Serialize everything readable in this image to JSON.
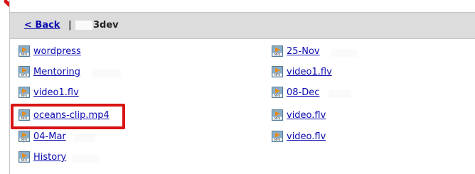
{
  "nav": {
    "back_label": "< Back",
    "separator": "|",
    "folder": "3dev"
  },
  "files_left": [
    {
      "name": "wordpress",
      "icon": "mp4-file-icon"
    },
    {
      "name": "Mentoring",
      "icon": "mp4-file-icon"
    },
    {
      "name": "video1.flv",
      "icon": "mp4-file-icon"
    },
    {
      "name": "oceans-clip.mp4",
      "icon": "mp4-file-icon"
    },
    {
      "name": "04-Mar",
      "icon": "mp4-file-icon"
    },
    {
      "name": "History",
      "icon": "mp4-file-icon"
    }
  ],
  "files_right": [
    {
      "name": "25-Nov",
      "icon": "mp4-file-icon"
    },
    {
      "name": "video1.flv",
      "icon": "mp4-file-icon"
    },
    {
      "name": "08-Dec",
      "icon": "mp4-file-icon"
    },
    {
      "name": "video.flv",
      "icon": "mp4-file-icon"
    },
    {
      "name": "video.flv",
      "icon": "mp4-file-icon"
    }
  ],
  "colors": {
    "link": "#0b0bb0",
    "highlight": "#d91414",
    "header_bg": "#dcdcdc"
  }
}
